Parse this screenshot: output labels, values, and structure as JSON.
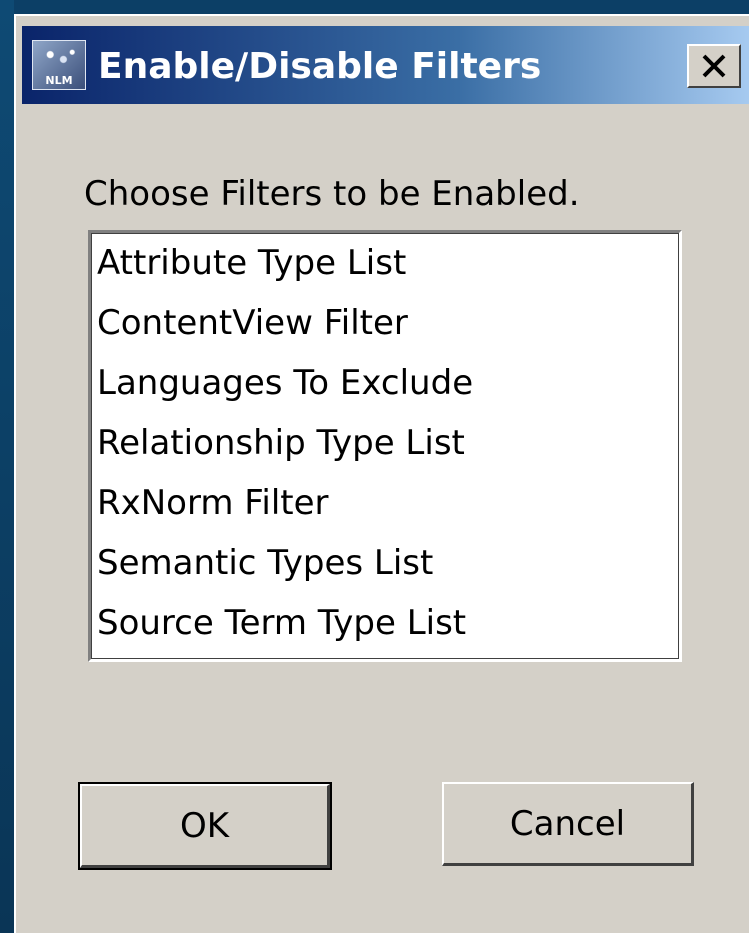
{
  "window": {
    "title": "Enable/Disable Filters",
    "icon": "nlm-app-icon",
    "icon_text": "NLM",
    "close_icon": "close-icon"
  },
  "prompt": "Choose Filters to be Enabled.",
  "filters": [
    "Attribute Type List",
    "ContentView Filter",
    "Languages To Exclude",
    "Relationship Type List",
    "RxNorm Filter",
    "Semantic Types List",
    "Source Term Type List"
  ],
  "buttons": {
    "ok_label": "OK",
    "cancel_label": "Cancel"
  },
  "colors": {
    "titlebar_start": "#0a246a",
    "titlebar_end": "#a6caf0",
    "dialog_bg": "#d4d0c8"
  }
}
